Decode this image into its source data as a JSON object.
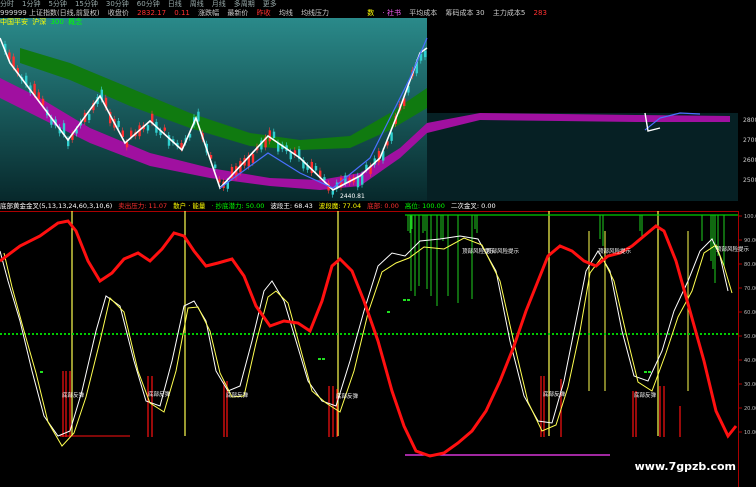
{
  "menu": [
    "分时",
    "1分钟",
    "5分钟",
    "15分钟",
    "30分钟",
    "60分钟",
    "日线",
    "周线",
    "月线",
    "多周期",
    "更多"
  ],
  "quote": {
    "code": "999999 上证指数(日线,前复权)",
    "price_label": "收盘价",
    "price": "2832.17",
    "change": "0.11",
    "pct": "涨跌幅",
    "extra": [
      "最新价",
      "昨收",
      "均线",
      "均线压力"
    ],
    "right_items": [
      "数",
      "· 社书",
      "平均成本",
      "筹码成本 30",
      "主力成本5"
    ],
    "right_val": "283"
  },
  "tags": [
    "中国平安",
    "沪深",
    "300",
    "概念"
  ],
  "upper_panel": {
    "price_ticks": [
      "2800",
      "2700",
      "2600",
      "2500"
    ],
    "low_label": "2440.81"
  },
  "lower_header": [
    {
      "text": "底部黄金金叉(5,13,13,24,60,3,10,6)",
      "color": "#ffffff"
    },
    {
      "text": "卖出压力: 11.07",
      "color": "#ff3030"
    },
    {
      "text": "散户 · 能量",
      "color": "#ffff00"
    },
    {
      "text": "· 抄底潜力: 50.00",
      "color": "#00ff00"
    },
    {
      "text": "波段王: 68.43",
      "color": "#ffffff"
    },
    {
      "text": "波段魔: 77.04",
      "color": "#ffff00"
    },
    {
      "text": "底部: 0.00",
      "color": "#ff3030"
    },
    {
      "text": "高位: 100.00",
      "color": "#00ff00"
    },
    {
      "text": "二次金叉: 0.00",
      "color": "#ffffff"
    }
  ],
  "lower_panel": {
    "y_ticks": [
      "100.00",
      "90.00",
      "80.00",
      "70.00",
      "60.00",
      "50.00",
      "40.00",
      "30.00",
      "20.00",
      "10.00"
    ],
    "signal_bottom": "底部反弹",
    "signal_top": "顶部风险提示"
  },
  "watermark": "www.7gpzb.com",
  "colors": {
    "red": "#ff1010",
    "green": "#00cc00",
    "purple": "#aa00aa",
    "yellow": "#ffff50",
    "white": "#ffffff"
  }
}
